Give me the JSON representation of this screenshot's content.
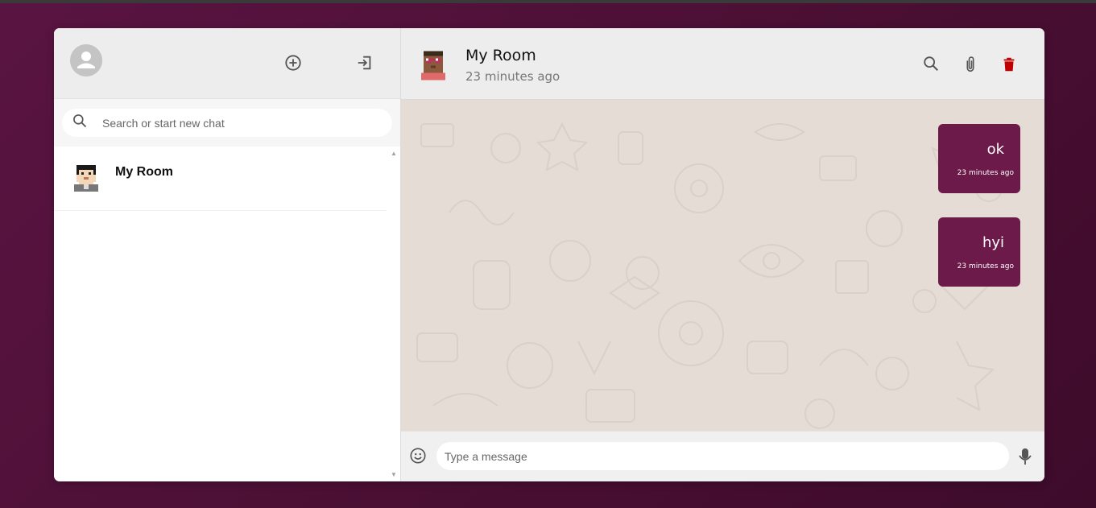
{
  "sidebar": {
    "search": {
      "placeholder": "Search or start new chat"
    },
    "chats": [
      {
        "name": "My Room"
      }
    ]
  },
  "chat": {
    "title": "My Room",
    "subtitle": "23 minutes ago",
    "messages": [
      {
        "text": "ok",
        "time": "23 minutes ago"
      },
      {
        "text": "hyi",
        "time": "23 minutes ago"
      }
    ],
    "composer": {
      "placeholder": "Type a message"
    }
  },
  "colors": {
    "background": "#5a1442",
    "bubble": "#6b1a4a",
    "header": "#ededed",
    "chat_bg": "#e5ddd5",
    "delete": "#c00000"
  },
  "icons": {
    "sidebar_header": [
      "user-avatar-icon",
      "add-chat-icon",
      "logout-icon"
    ],
    "chat_header": [
      "search-icon",
      "attach-icon",
      "delete-icon"
    ],
    "composer": [
      "emoji-icon",
      "mic-icon"
    ]
  }
}
